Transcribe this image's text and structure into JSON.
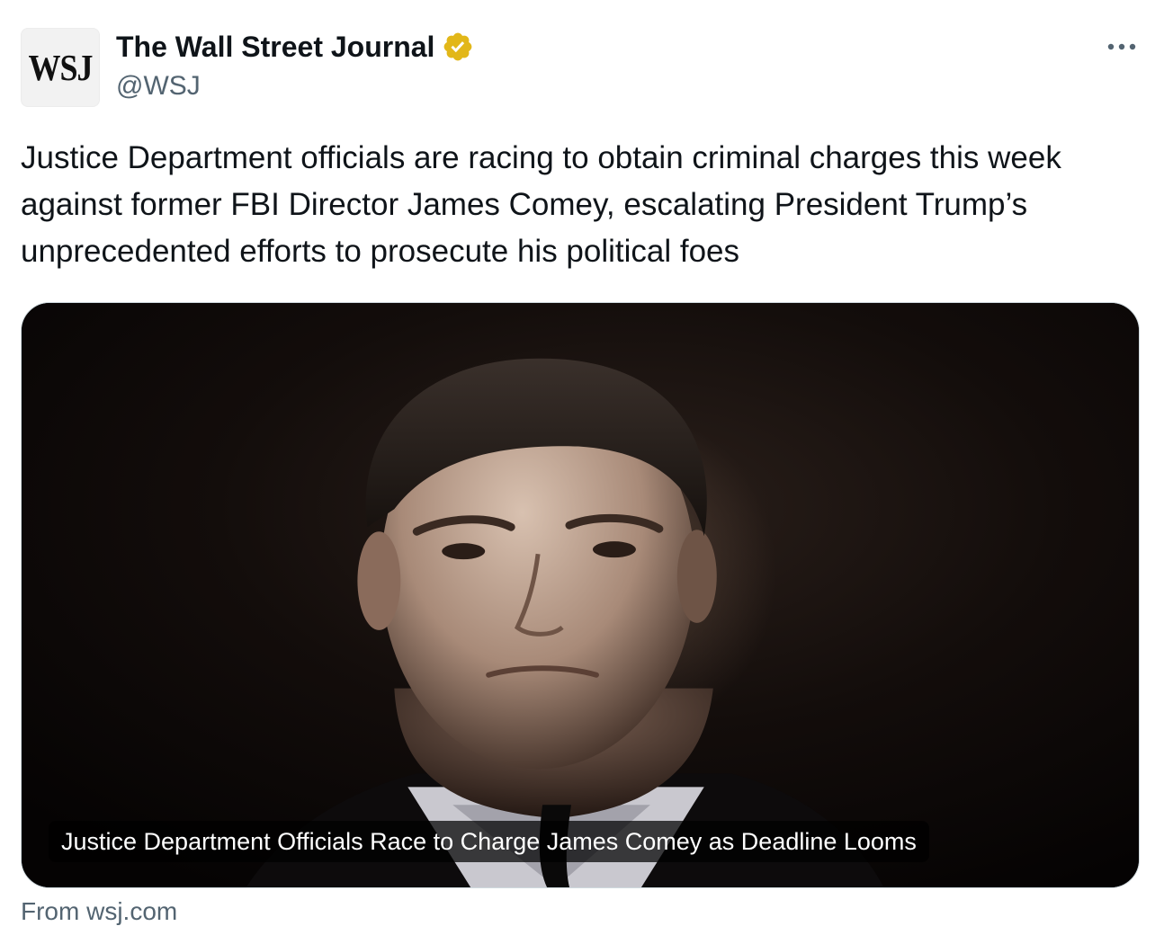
{
  "author": {
    "avatar_text": "WSJ",
    "display_name": "The Wall Street Journal",
    "handle": "@WSJ",
    "verified_icon": "verified-gold-badge-icon",
    "verified_color": "#e2b719"
  },
  "menu": {
    "more_icon": "more-options-icon"
  },
  "tweet": {
    "text": "Justice Department officials are racing to obtain criminal charges this week against former FBI Director James Comey, escalating President Trump’s unprecedented efforts to prosecute his political foes"
  },
  "link_card": {
    "caption": "Justice Department Officials Race to Charge James Comey as Deadline Looms",
    "source": "From wsj.com"
  }
}
